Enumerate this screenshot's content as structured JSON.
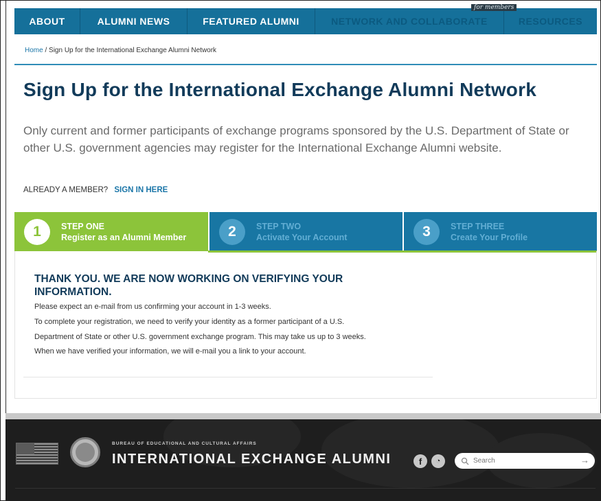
{
  "nav": {
    "items": [
      {
        "label": "ABOUT"
      },
      {
        "label": "ALUMNI NEWS"
      },
      {
        "label": "FEATURED ALUMNI"
      },
      {
        "label": "NETWORK AND COLLABORATE"
      },
      {
        "label": "RESOURCES"
      }
    ],
    "members_tag": "for members"
  },
  "breadcrumb": {
    "home": "Home",
    "separator": " / ",
    "current": "Sign Up for the International Exchange Alumni Network"
  },
  "page": {
    "title": "Sign Up for the International Exchange Alumni Network",
    "intro": "Only current and former participants of exchange programs sponsored by the U.S. Department of State or other U.S. government agencies may register for the International Exchange Alumni website.",
    "already_member": "ALREADY A MEMBER?",
    "sign_in": "SIGN IN HERE"
  },
  "steps": [
    {
      "num": "1",
      "title": "STEP ONE",
      "desc": "Register as an Alumni Member",
      "active": true
    },
    {
      "num": "2",
      "title": "STEP TWO",
      "desc": "Activate Your Account",
      "active": false
    },
    {
      "num": "3",
      "title": "STEP THREE",
      "desc": "Create Your Profile",
      "active": false
    }
  ],
  "message": {
    "heading": "THANK YOU. WE ARE NOW WORKING ON VERIFYING YOUR INFORMATION.",
    "line1": "Please expect an e-mail from us confirming your account in 1-3 weeks.",
    "line2": "To complete your registration, we need to verify your identity as a former participant of a U.S.",
    "line3": "Department of State or other U.S. government exchange program. This may take us up to 3 weeks.",
    "line4": "When we have verified your information, we will e-mail you a link to your account."
  },
  "footer": {
    "bureau": "BUREAU OF EDUCATIONAL AND CULTURAL AFFAIRS",
    "brand": "INTERNATIONAL EXCHANGE ALUMNI",
    "facebook": "f",
    "rss": "◔",
    "search_placeholder": "Search",
    "search_arrow": "→"
  },
  "colors": {
    "nav_blue": "#15709a",
    "step_green": "#8cc43a",
    "step_blue": "#1876a3",
    "title_navy": "#123b5a",
    "link_blue": "#1b76a8",
    "footer_bg": "#1e1e1e"
  }
}
